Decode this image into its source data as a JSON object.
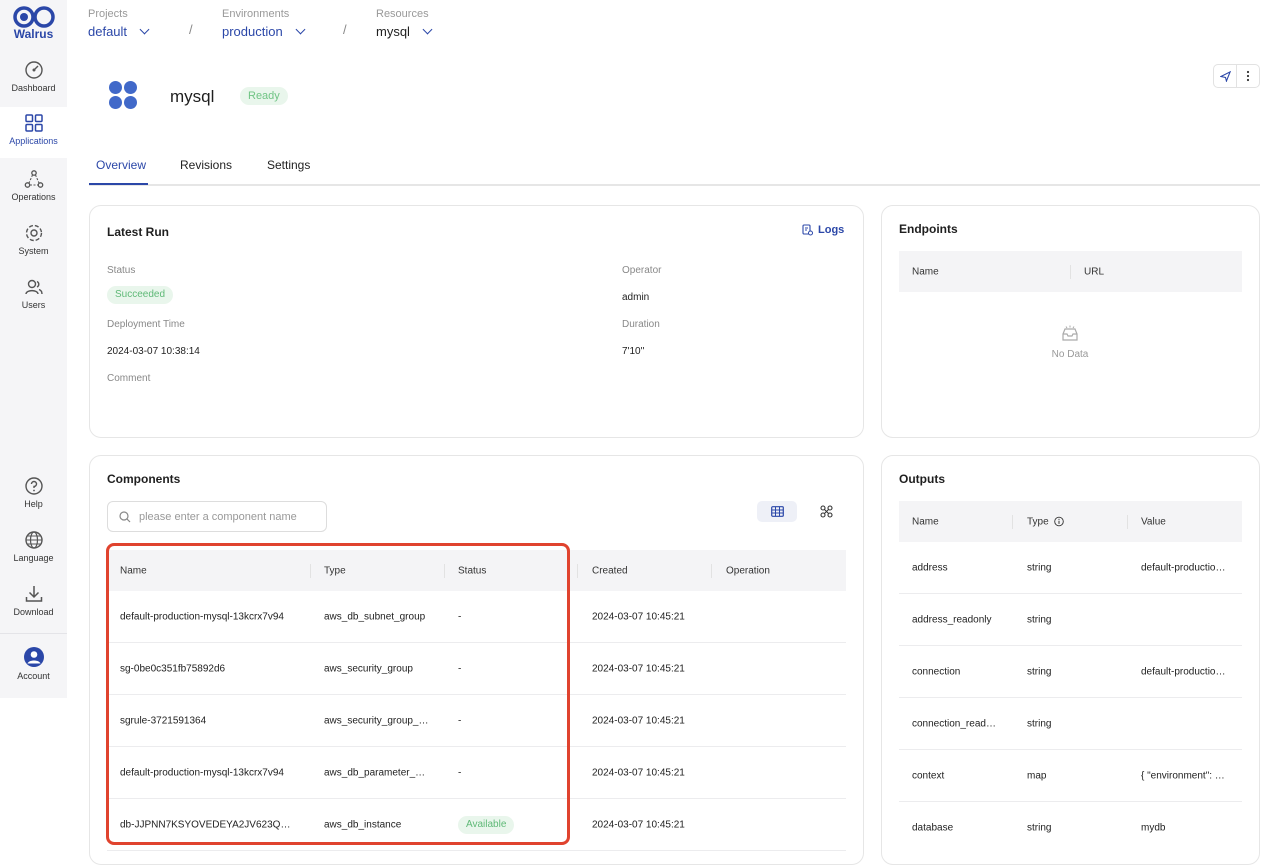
{
  "brand": {
    "name": "Walrus"
  },
  "nav": {
    "dashboard": "Dashboard",
    "applications": "Applications",
    "operations": "Operations",
    "system": "System",
    "users": "Users",
    "help": "Help",
    "language": "Language",
    "download": "Download",
    "account": "Account"
  },
  "breadcrumb": {
    "projects": {
      "label": "Projects",
      "value": "default"
    },
    "environments": {
      "label": "Environments",
      "value": "production"
    },
    "resources": {
      "label": "Resources",
      "value": "mysql"
    },
    "separator": "/"
  },
  "app": {
    "name": "mysql",
    "status": "Ready"
  },
  "tabs": [
    "Overview",
    "Revisions",
    "Settings"
  ],
  "latest_run": {
    "title": "Latest Run",
    "logs_label": "Logs",
    "status_label": "Status",
    "status_value": "Succeeded",
    "operator_label": "Operator",
    "operator_value": "admin",
    "deployment_time_label": "Deployment Time",
    "deployment_time_value": "2024-03-07 10:38:14",
    "duration_label": "Duration",
    "duration_value": "7'10''",
    "comment_label": "Comment"
  },
  "endpoints": {
    "title": "Endpoints",
    "columns": [
      "Name",
      "URL"
    ],
    "empty_text": "No Data"
  },
  "components": {
    "title": "Components",
    "search_placeholder": "please enter a component name",
    "columns": [
      "Name",
      "Type",
      "Status",
      "Created",
      "Operation"
    ],
    "rows": [
      {
        "name": "default-production-mysql-13kcrx7v94",
        "type": "aws_db_subnet_group",
        "status": "-",
        "created": "2024-03-07 10:45:21"
      },
      {
        "name": "sg-0be0c351fb75892d6",
        "type": "aws_security_group",
        "status": "-",
        "created": "2024-03-07 10:45:21"
      },
      {
        "name": "sgrule-3721591364",
        "type": "aws_security_group_…",
        "status": "-",
        "created": "2024-03-07 10:45:21"
      },
      {
        "name": "default-production-mysql-13kcrx7v94",
        "type": "aws_db_parameter_…",
        "status": "-",
        "created": "2024-03-07 10:45:21"
      },
      {
        "name": "db-JJPNN7KSYOVEDEYA2JV623Q…",
        "type": "aws_db_instance",
        "status": "Available",
        "created": "2024-03-07 10:45:21"
      }
    ]
  },
  "outputs": {
    "title": "Outputs",
    "columns": [
      "Name",
      "Type",
      "Value"
    ],
    "rows": [
      {
        "name": "address",
        "type": "string",
        "value": "default-productio…"
      },
      {
        "name": "address_readonly",
        "type": "string",
        "value": ""
      },
      {
        "name": "connection",
        "type": "string",
        "value": "default-productio…"
      },
      {
        "name": "connection_read…",
        "type": "string",
        "value": ""
      },
      {
        "name": "context",
        "type": "map",
        "value": "{ \"environment\": …"
      },
      {
        "name": "database",
        "type": "string",
        "value": "mydb"
      }
    ]
  },
  "colors": {
    "accent": "#2b47a8",
    "success_bg": "#e9f6ec",
    "success_text": "#5fb977",
    "highlight": "#e0432e"
  }
}
